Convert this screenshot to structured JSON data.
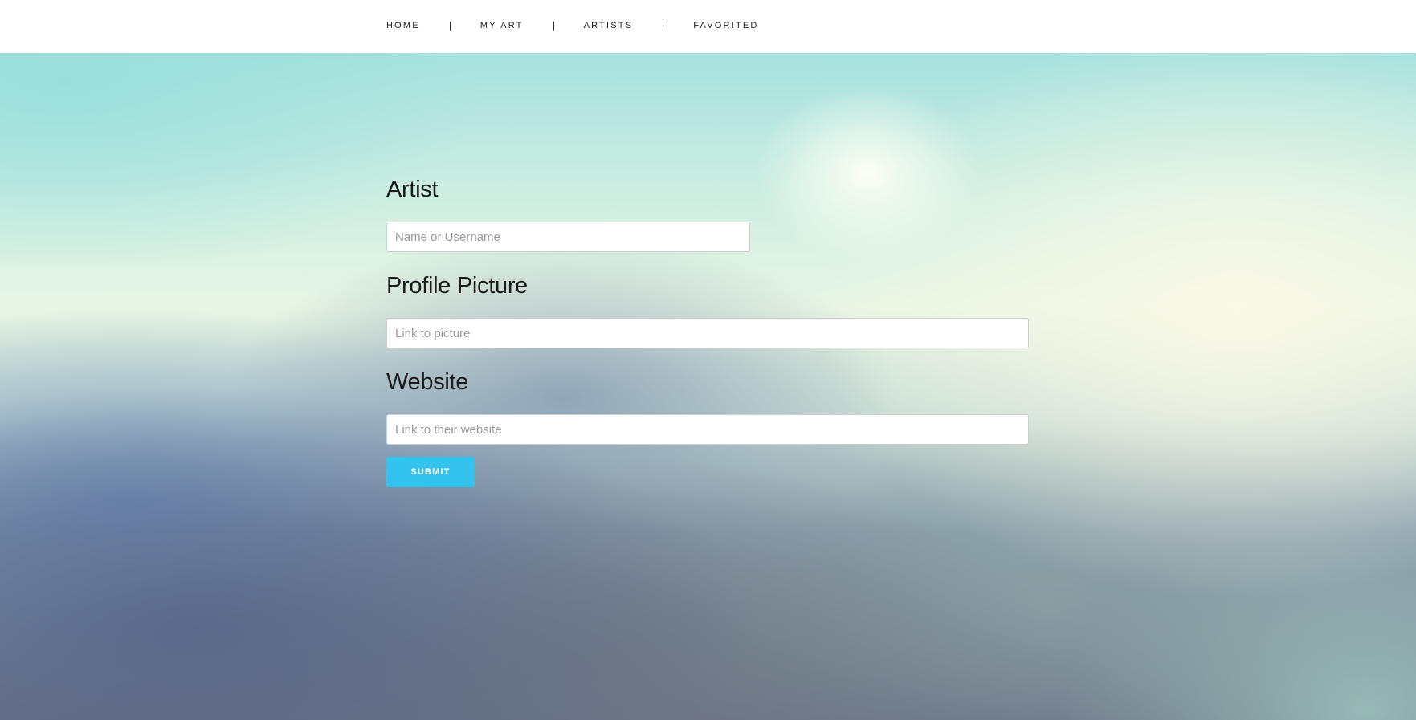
{
  "nav": {
    "items": [
      {
        "label": "HOME"
      },
      {
        "label": "MY ART"
      },
      {
        "label": "ARTISTS"
      },
      {
        "label": "FAVORITED"
      }
    ],
    "separator": "|"
  },
  "form": {
    "artist": {
      "title": "Artist",
      "value": "",
      "placeholder": "Name or Username"
    },
    "profile_picture": {
      "title": "Profile Picture",
      "value": "",
      "placeholder": "Link to picture"
    },
    "website": {
      "title": "Website",
      "value": "",
      "placeholder": "Link to their website"
    },
    "submit_label": "SUBMIT"
  },
  "colors": {
    "accent": "#33c3ee",
    "text": "#1b1b1b",
    "header_bg": "#ffffff"
  }
}
